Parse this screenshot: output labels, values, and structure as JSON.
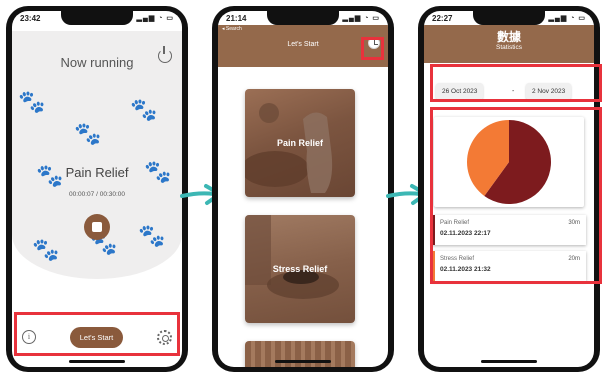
{
  "screen1": {
    "time": "23:42",
    "title": "Now running",
    "program": "Pain Relief",
    "elapsed": "00:00:07",
    "separator": "/",
    "total": "00:30:00",
    "start_label": "Let's Start",
    "info_icon": "info-icon",
    "settings_icon": "gear-icon",
    "power_icon": "power-icon",
    "stop_icon": "stop-icon"
  },
  "screen2": {
    "time": "21:14",
    "back_label": "◂ Search",
    "title": "Let's Start",
    "history_icon": "clock-icon",
    "tiles": [
      {
        "label": "Pain Relief"
      },
      {
        "label": "Stress Relief"
      },
      {
        "label": ""
      }
    ]
  },
  "screen3": {
    "time": "22:27",
    "title_cn": "數據",
    "title": "Statistics",
    "date_from": "26 Oct 2023",
    "date_sep": "-",
    "date_to": "2 Nov 2023",
    "pie": [
      {
        "name": "Pain Relief",
        "minutes": 30,
        "color": "#7d1b1e"
      },
      {
        "name": "Stress Relief",
        "minutes": 20,
        "color": "#f37a35"
      }
    ],
    "sessions": [
      {
        "name": "Pain Relief",
        "datetime": "02.11.2023 22:17",
        "duration": "30m",
        "color": "#7d1b1e"
      },
      {
        "name": "Stress Relief",
        "datetime": "02.11.2023 21:32",
        "duration": "20m",
        "color": "#f37a35"
      }
    ]
  },
  "colors": {
    "brand_brown": "#8a5a3c",
    "header_brown": "#94694b",
    "arrow_teal": "#3cb7b4",
    "highlight_red": "#e8323c"
  }
}
